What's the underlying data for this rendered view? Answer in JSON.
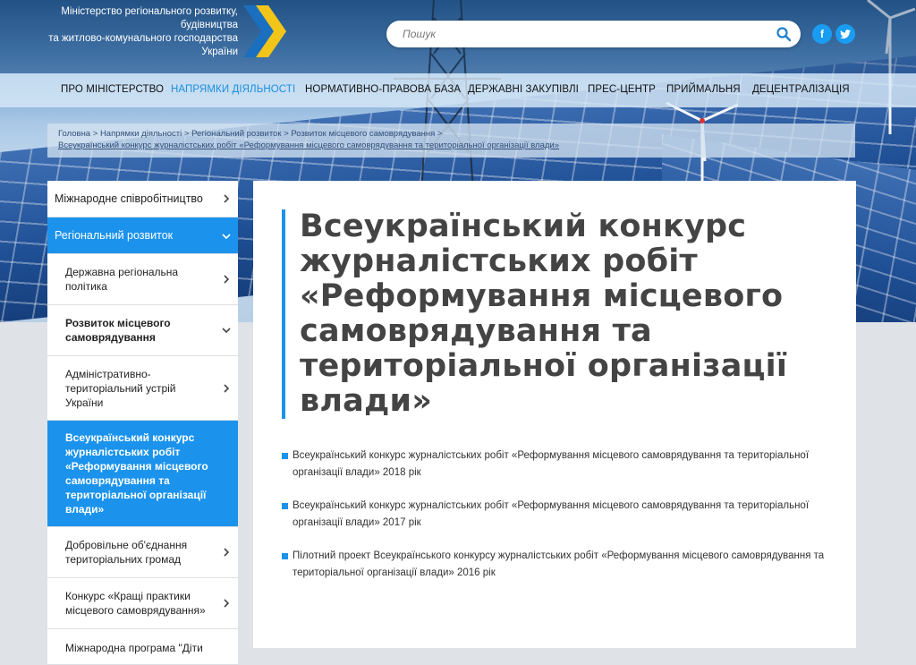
{
  "header": {
    "ministry_lines": [
      "Міністерство регіонального розвитку,",
      "будівництва",
      "та житлово-комунального господарства",
      "України"
    ],
    "search_placeholder": "Пошук",
    "social": [
      {
        "icon": "facebook-icon",
        "glyph": "f"
      },
      {
        "icon": "twitter-icon",
        "glyph": "t"
      }
    ]
  },
  "nav": {
    "items": [
      "ПРО МІНІСТЕРСТВО",
      "НАПРЯМКИ ДІЯЛЬНОСТІ",
      "НОРМАТИВНО-ПРАВОВА БАЗА",
      "ДЕРЖАВНІ ЗАКУПІВЛІ",
      "ПРЕС-ЦЕНТР",
      "ПРИЙМАЛЬНЯ",
      "ДЕЦЕНТРАЛІЗАЦІЯ"
    ],
    "active": "НАПРЯМКИ ДІЯЛЬНОСТІ"
  },
  "breadcrumb": {
    "items": [
      "Головна",
      "Напрямки діяльності",
      "Регіональний розвиток",
      "Розвиток місцевого самоврядування",
      "Всеукраїнський конкурс журналістських робіт «Реформування місцевого самоврядування та територіальної організації влади»"
    ],
    "separator": ">"
  },
  "sidebar": {
    "top_items": [
      {
        "label": "Міжнародне співробітництво",
        "active": false
      },
      {
        "label": "Регіональний розвиток",
        "active": true
      }
    ],
    "sub_items": [
      {
        "label": "Державна регіональна політика"
      },
      {
        "label": "Розвиток місцевого самоврядування"
      },
      {
        "label": "Адміністративно-територіальний устрій України"
      },
      {
        "label": "Всеукраїнський конкурс журналістських робіт «Реформування місцевого самоврядування та територіальної організації влади»"
      },
      {
        "label": "Добровільне об'єднання територіальних громад"
      },
      {
        "label": "Конкурс «Кращі практики місцевого самоврядування»"
      },
      {
        "label": "Міжнародна програма \"Діти"
      }
    ]
  },
  "content": {
    "title": "Всеукраїнський конкурс журналістських робіт «Реформування місцевого самоврядування та територіальної організації влади»",
    "documents": [
      "Всеукраїнський конкурс журналістських робіт «Реформування місцевого самоврядування та територіальної організації влади» 2018 рік",
      "Всеукраїнський конкурс журналістських робіт «Реформування місцевого самоврядування та територіальної організації влади» 2017 рік",
      "Пілотний проект Всеукраїнського конкурсу журналістських робіт «Реформування місцевого самоврядування та територіальної організації влади» 2016 рік"
    ]
  },
  "colors": {
    "accent": "#1b93ec",
    "nav_active": "#1b8fe0",
    "title_text": "#444444"
  }
}
